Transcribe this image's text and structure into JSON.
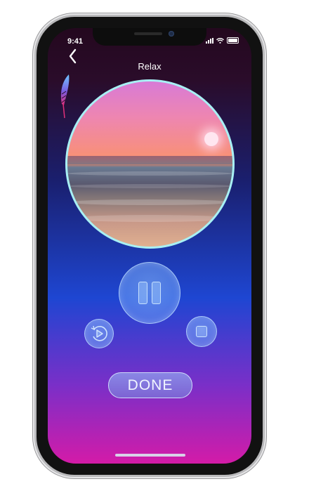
{
  "status_bar": {
    "time": "9:41"
  },
  "header": {
    "title": "Relax"
  },
  "controls": {
    "done_label": "DONE"
  },
  "icons": {
    "back": "chevron-left-icon",
    "feather": "feather-icon",
    "pause": "pause-icon",
    "replay": "replay-icon",
    "stop": "stop-icon"
  },
  "colors": {
    "background_top": "#24081e",
    "background_mid": "#1e46d2",
    "background_bottom": "#d41ba8",
    "artwork_ring": "#a8f0f4"
  }
}
